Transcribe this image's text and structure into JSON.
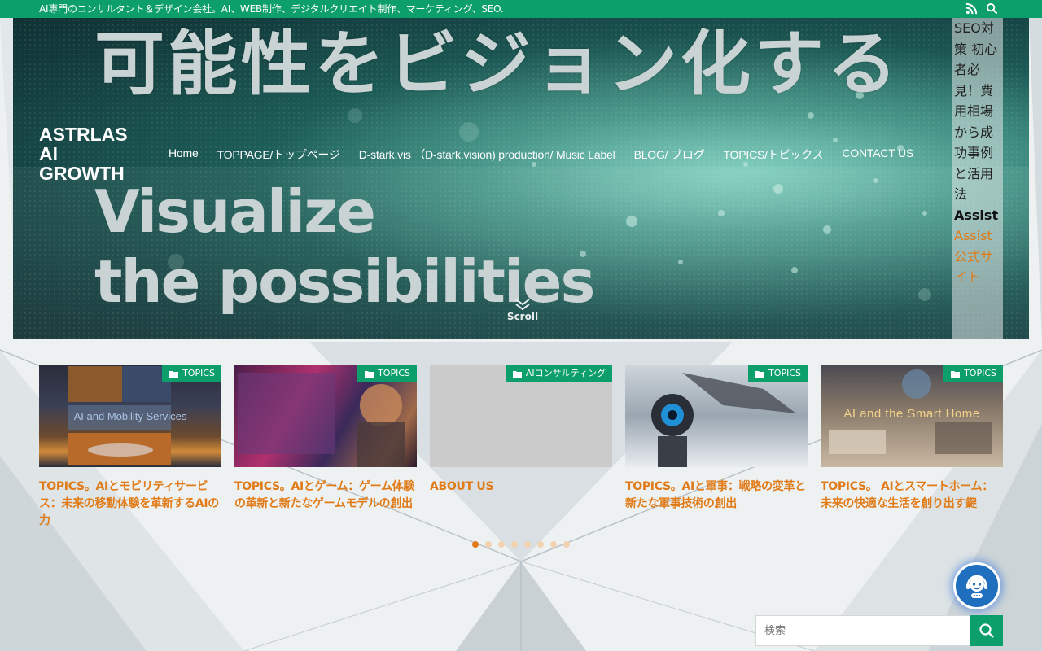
{
  "topbar": {
    "tagline": "AI専門のコンサルタント＆デザイン会社。AI、WEB制作、デジタルクリエイト制作、マーケティング、SEO.",
    "icons": [
      "rss-icon",
      "search-icon"
    ]
  },
  "hero": {
    "headline_jp": "可能性をビジョン化する",
    "headline_en_line1": "Visualize",
    "headline_en_line2": "the possibilities",
    "scroll_label": "Scroll"
  },
  "logo": {
    "text": "ASTRLAS AI GROWTH"
  },
  "nav": {
    "items": [
      {
        "label": "Home"
      },
      {
        "label": "TOPPAGE/トップページ"
      },
      {
        "label": "D-stark.vis （D-stark.vision) production/ Music Label"
      },
      {
        "label": "BLOG/ ブログ"
      },
      {
        "label": "TOPICS/トピックス"
      },
      {
        "label": "CONTACT US"
      }
    ]
  },
  "side": {
    "text": "SEO対策 初心者必見！費用相場から成功事例と活用法",
    "bold": "Assist",
    "link": "Assist公式サイト"
  },
  "cards": [
    {
      "badge": "TOPICS",
      "title": "TOPICS。AIとモビリティサービス：未来の移動体験を革新するAIの力",
      "thumb_text": "AI and Mobility Services"
    },
    {
      "badge": "TOPICS",
      "title": "TOPICS。AIとゲーム：ゲーム体験の革新と新たなゲームモデルの創出",
      "thumb_text": ""
    },
    {
      "badge": "AIコンサルティング",
      "title": "ABOUT US",
      "thumb_text": ""
    },
    {
      "badge": "TOPICS",
      "title": "TOPICS。AIと軍事：戦略の変革と新たな軍事技術の創出",
      "thumb_text": ""
    },
    {
      "badge": "TOPICS",
      "title": "TOPICS。 AIとスマートホーム：未来の快適な生活を創り出す鍵",
      "thumb_text": "AI and the Smart Home"
    }
  ],
  "pager": {
    "count": 8,
    "active": 0
  },
  "search": {
    "placeholder": "検索"
  },
  "colors": {
    "brand_green": "#0c9e6b",
    "accent_orange": "#e07b17",
    "chat_blue": "#1f6fbe"
  }
}
